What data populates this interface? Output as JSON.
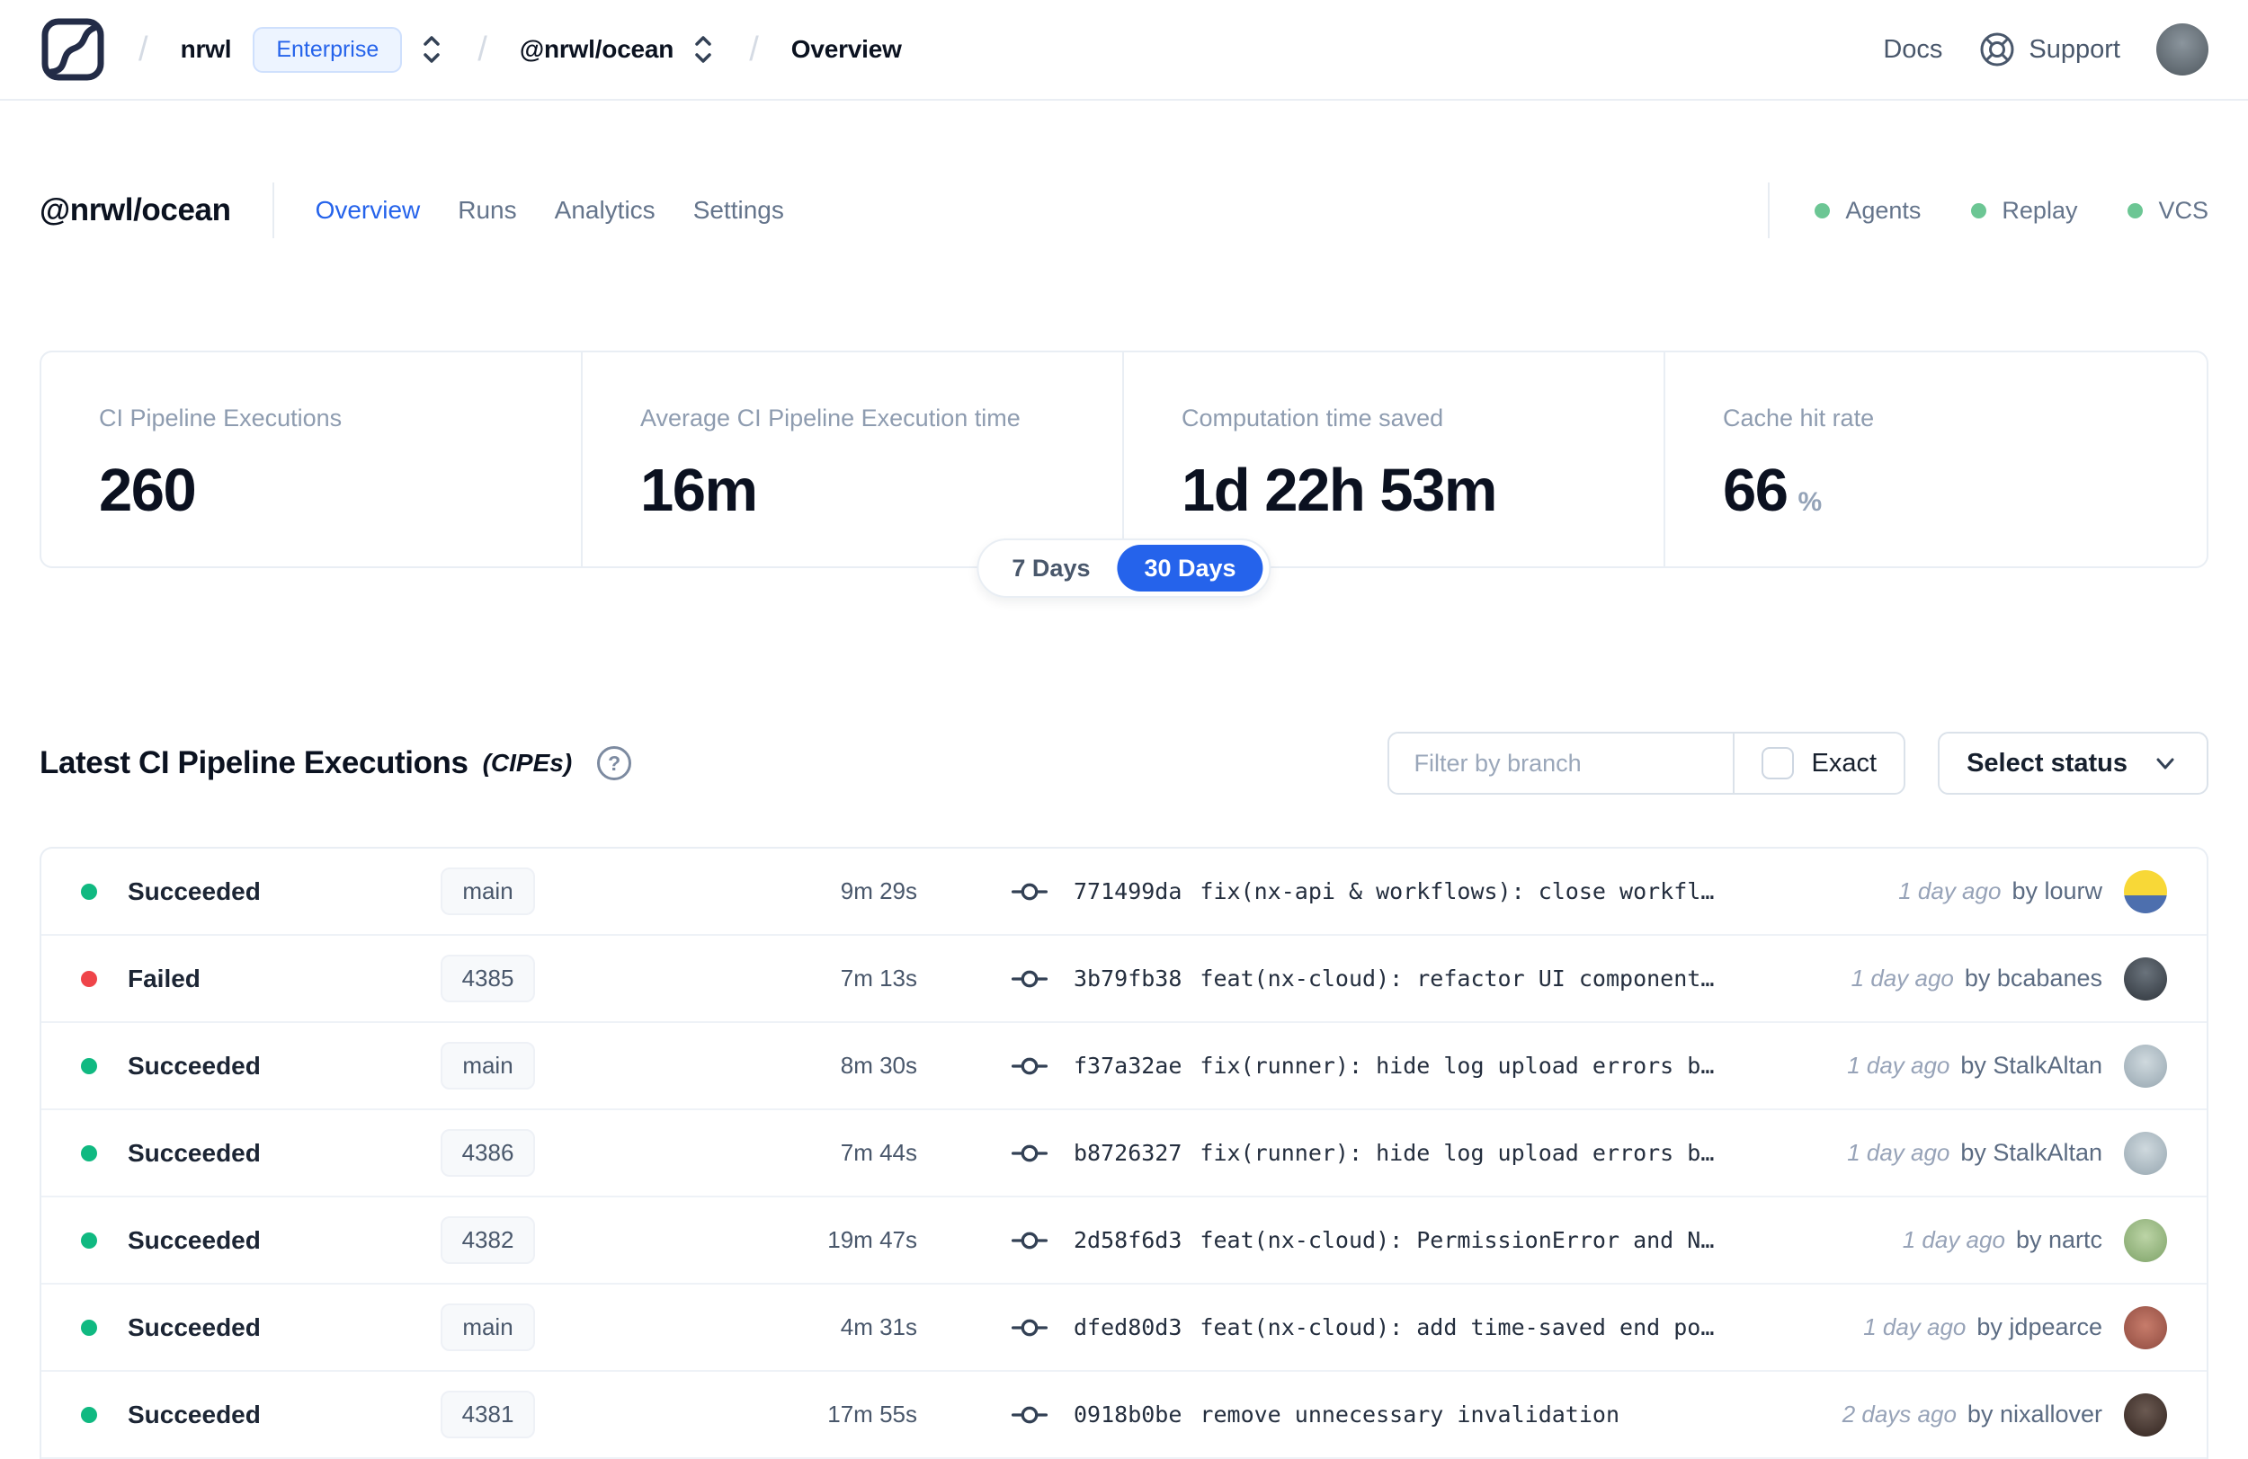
{
  "header": {
    "breadcrumb": {
      "org": "nrwl",
      "org_badge": "Enterprise",
      "workspace": "@nrwl/ocean",
      "page": "Overview"
    },
    "docs_label": "Docs",
    "support_label": "Support"
  },
  "workspace": {
    "title": "@nrwl/ocean",
    "tabs": [
      {
        "label": "Overview",
        "active": true
      },
      {
        "label": "Runs",
        "active": false
      },
      {
        "label": "Analytics",
        "active": false
      },
      {
        "label": "Settings",
        "active": false
      }
    ],
    "status_indicators": [
      "Agents",
      "Replay",
      "VCS"
    ]
  },
  "stats": {
    "cards": [
      {
        "label": "CI Pipeline Executions",
        "value": "260",
        "suffix": ""
      },
      {
        "label": "Average CI Pipeline Execution time",
        "value": "16m",
        "suffix": ""
      },
      {
        "label": "Computation time saved",
        "value": "1d 22h 53m",
        "suffix": ""
      },
      {
        "label": "Cache hit rate",
        "value": "66",
        "suffix": "%"
      }
    ],
    "range_toggle": {
      "options": [
        "7 Days",
        "30 Days"
      ],
      "selected": "30 Days"
    }
  },
  "cipe_section": {
    "title": "Latest CI Pipeline Executions",
    "title_suffix": "(CIPEs)",
    "help_glyph": "?",
    "filter_placeholder": "Filter by branch",
    "exact_label": "Exact",
    "exact_checked": false,
    "status_dropdown_label": "Select status",
    "rows": [
      {
        "status": "Succeeded",
        "branch": "main",
        "duration": "9m 29s",
        "commit_hash": "771499da",
        "commit_message": "fix(nx-api & workflows): close workfl…",
        "time_ago": "1 day ago",
        "author": "by lourw",
        "avatar_color": "linear-gradient(180deg,#f8d837 58%,#4d6fae 58%)"
      },
      {
        "status": "Failed",
        "branch": "4385",
        "duration": "7m 13s",
        "commit_hash": "3b79fb38",
        "commit_message": "feat(nx-cloud): refactor UI component…",
        "time_ago": "1 day ago",
        "author": "by bcabanes",
        "avatar_color": "radial-gradient(circle at 50% 35%,#6a737c,#2f353c)"
      },
      {
        "status": "Succeeded",
        "branch": "main",
        "duration": "8m 30s",
        "commit_hash": "f37a32ae",
        "commit_message": "fix(runner): hide log upload errors b…",
        "time_ago": "1 day ago",
        "author": "by StalkAltan",
        "avatar_color": "radial-gradient(circle at 50% 40%,#cfd9de,#96a6b0)"
      },
      {
        "status": "Succeeded",
        "branch": "4386",
        "duration": "7m 44s",
        "commit_hash": "b8726327",
        "commit_message": "fix(runner): hide log upload errors b…",
        "time_ago": "1 day ago",
        "author": "by StalkAltan",
        "avatar_color": "radial-gradient(circle at 50% 40%,#cfd9de,#96a6b0)"
      },
      {
        "status": "Succeeded",
        "branch": "4382",
        "duration": "19m 47s",
        "commit_hash": "2d58f6d3",
        "commit_message": "feat(nx-cloud): PermissionError and N…",
        "time_ago": "1 day ago",
        "author": "by nartc",
        "avatar_color": "radial-gradient(circle at 50% 40%,#bcd4a6,#7da267)"
      },
      {
        "status": "Succeeded",
        "branch": "main",
        "duration": "4m 31s",
        "commit_hash": "dfed80d3",
        "commit_message": "feat(nx-cloud): add time-saved end po…",
        "time_ago": "1 day ago",
        "author": "by jdpearce",
        "avatar_color": "radial-gradient(circle at 50% 45%,#c77c6b,#8e4a3f)"
      },
      {
        "status": "Succeeded",
        "branch": "4381",
        "duration": "17m 55s",
        "commit_hash": "0918b0be",
        "commit_message": "remove unnecessary invalidation",
        "time_ago": "2 days ago",
        "author": "by nixallover",
        "avatar_color": "radial-gradient(circle at 50% 40%,#6b5a52,#32241f)"
      }
    ]
  },
  "colors": {
    "accent_blue": "#2563eb",
    "succeeded": "#10b981",
    "failed": "#ef4449",
    "indicator_green": "#6cc694"
  }
}
